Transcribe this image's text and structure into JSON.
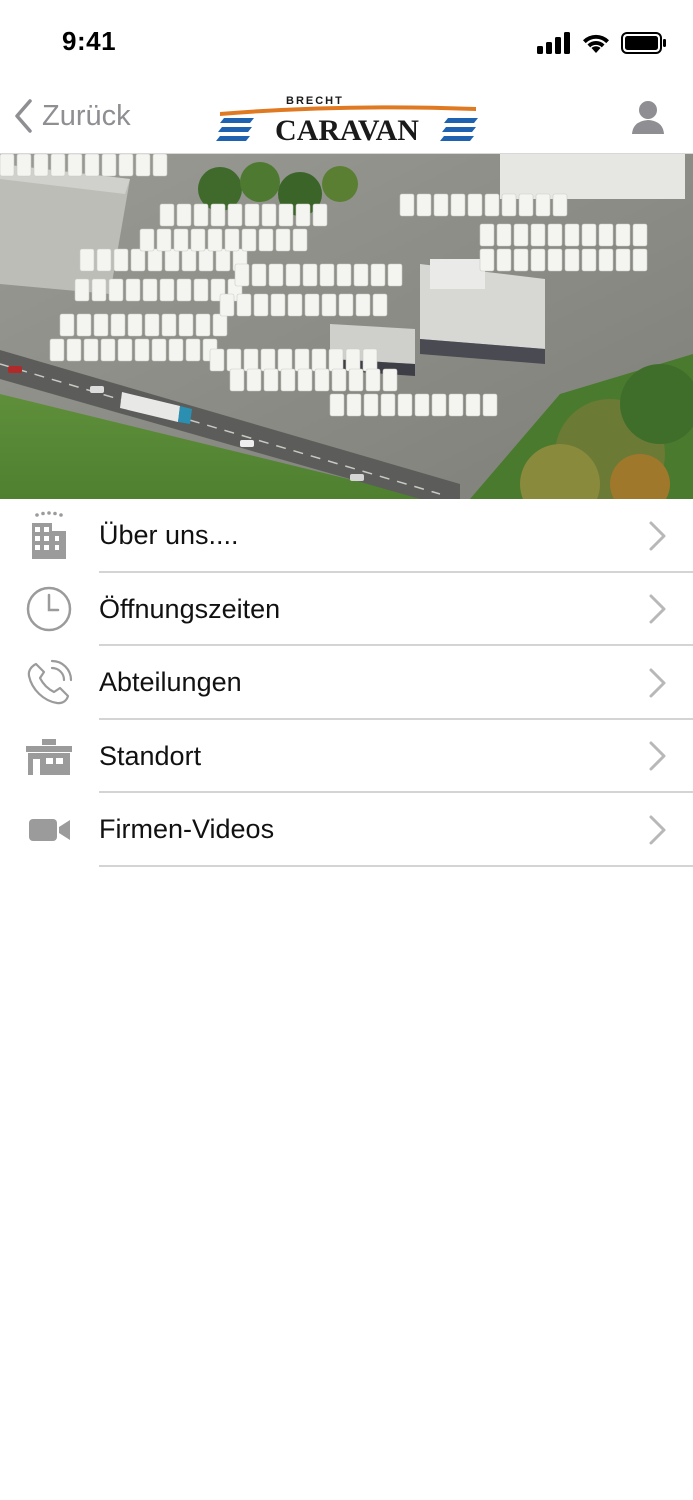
{
  "status_bar": {
    "time": "9:41"
  },
  "nav": {
    "back_label": "Zurück",
    "logo": {
      "top_text": "BRECHT",
      "main_text": "CARAVAN",
      "brand_color": "#1f63b0",
      "accent_color": "#e07a22"
    }
  },
  "hero": {
    "icon": "aerial-photo-dealer-lot"
  },
  "menu": {
    "items": [
      {
        "label": "Über uns....",
        "icon": "building-icon"
      },
      {
        "label": "Öffnungszeiten",
        "icon": "clock-icon"
      },
      {
        "label": "Abteilungen",
        "icon": "phone-icon"
      },
      {
        "label": "Standort",
        "icon": "location-building-icon"
      },
      {
        "label": "Firmen-Videos",
        "icon": "video-camera-icon"
      }
    ]
  },
  "colors": {
    "icon_gray": "#9b9b9b",
    "chevron_gray": "#b8b8b8",
    "divider": "#d4d4d4"
  }
}
